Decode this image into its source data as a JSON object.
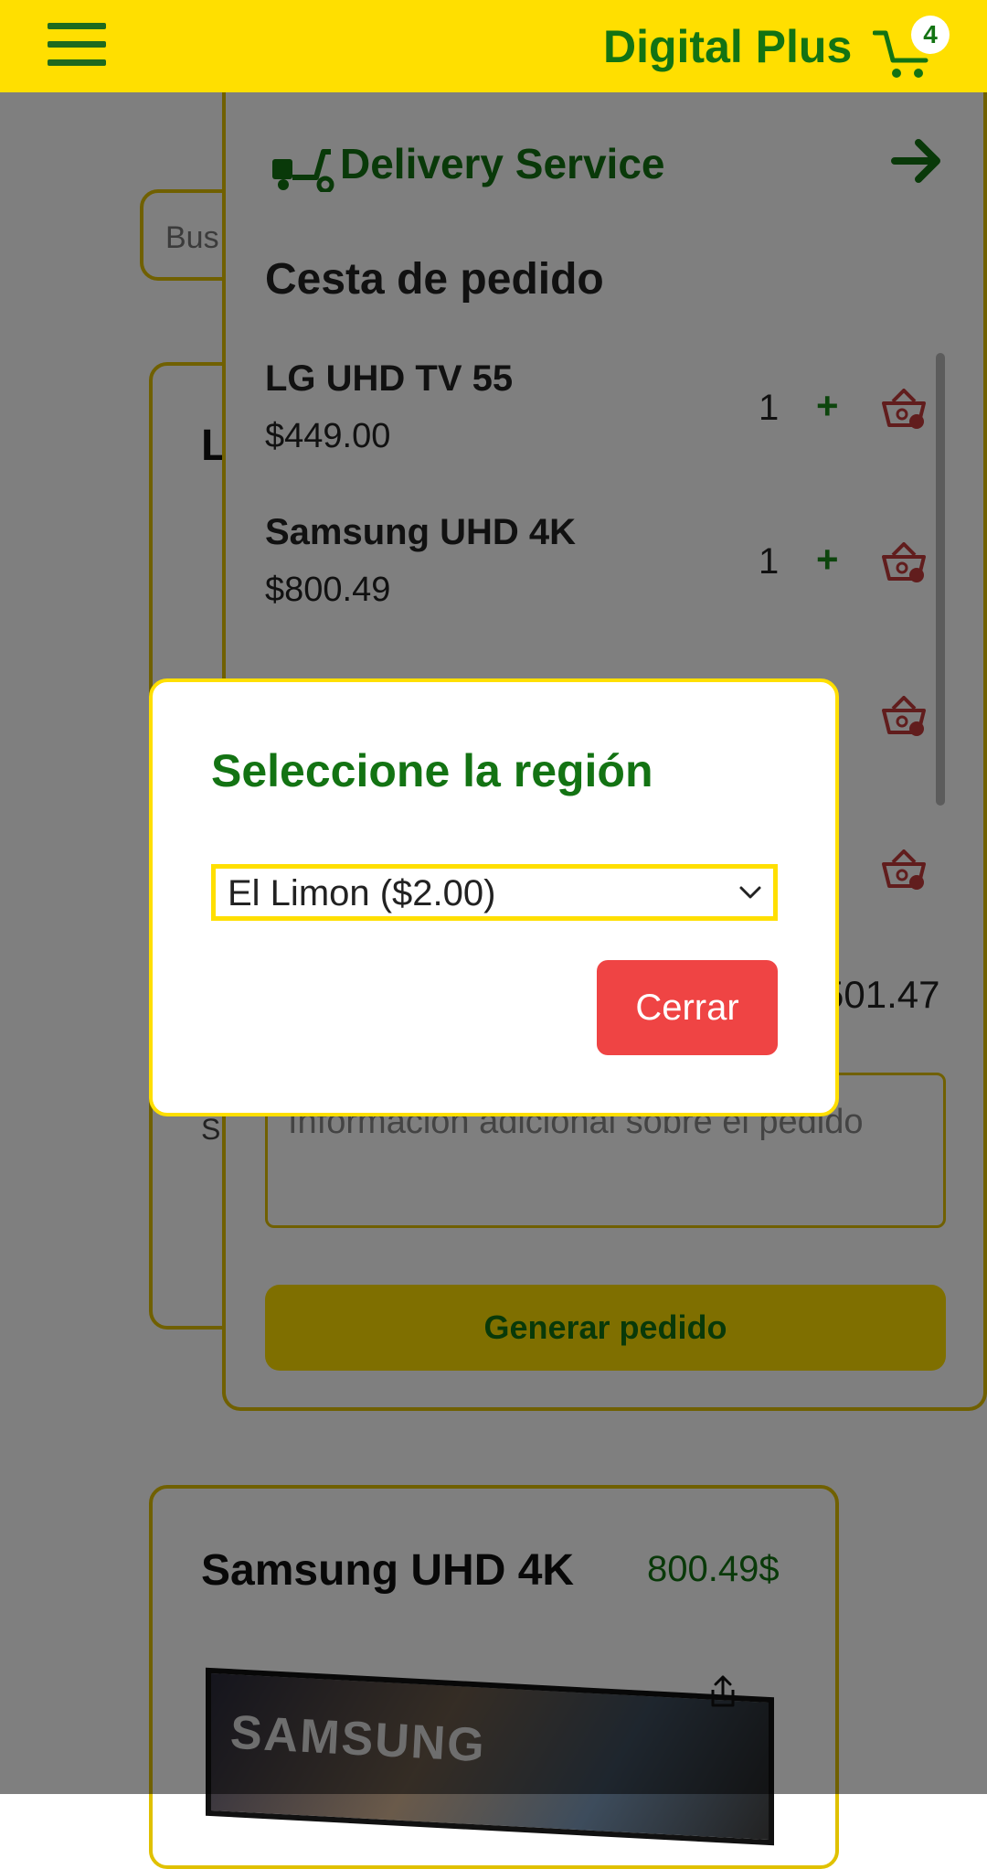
{
  "header": {
    "brand": "Digital Plus",
    "cart_count": "4",
    "colors": {
      "bar": "#ffdf00",
      "brand": "#137313"
    }
  },
  "page": {
    "search_placeholder": "Bus",
    "card1_initial": "L",
    "card1_text": "S",
    "card2": {
      "title": "Samsung UHD 4K",
      "price": "800.49$",
      "image_text": "SAMSUNG"
    }
  },
  "drawer": {
    "title": "Delivery Service",
    "basket_title": "Cesta de pedido",
    "items": [
      {
        "name": "LG UHD TV 55",
        "price": "$449.00",
        "qty": "1"
      },
      {
        "name": "Samsung UHD 4K",
        "price": "$800.49",
        "qty": "1"
      }
    ],
    "total_partial": "501.47",
    "notes_placeholder": "Información adicional sobre el pedido",
    "generate_label": "Generar pedido"
  },
  "modal": {
    "title": "Seleccione la región",
    "selected_region": "El Limon ($2.00)",
    "close_label": "Cerrar",
    "close_color": "#ef4444"
  }
}
